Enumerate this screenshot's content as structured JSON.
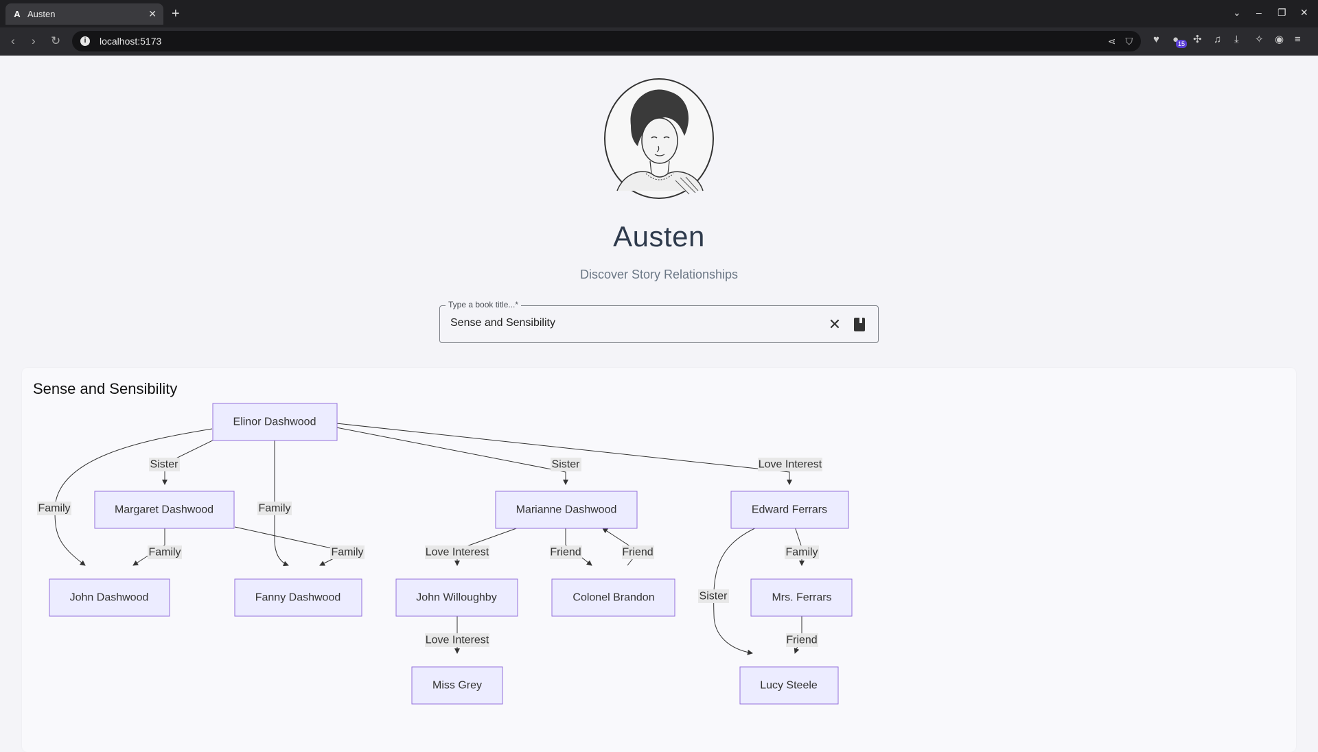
{
  "browser": {
    "tab_title": "Austen",
    "tab_favicon": "A",
    "url": "localhost:5173",
    "extension_badge": "15"
  },
  "app": {
    "title": "Austen",
    "subtitle": "Discover Story Relationships"
  },
  "search": {
    "label": "Type a book title...*",
    "value": "Sense and Sensibility"
  },
  "result": {
    "book_title": "Sense and Sensibility",
    "nodes": {
      "elinor": "Elinor Dashwood",
      "margaret": "Margaret Dashwood",
      "marianne": "Marianne Dashwood",
      "edward": "Edward Ferrars",
      "john_d": "John Dashwood",
      "fanny": "Fanny Dashwood",
      "willoughby": "John Willoughby",
      "brandon": "Colonel Brandon",
      "mrs_ferrars": "Mrs. Ferrars",
      "miss_grey": "Miss Grey",
      "lucy": "Lucy Steele"
    },
    "edges": {
      "elinor_margaret": "Sister",
      "elinor_marianne": "Sister",
      "elinor_edward": "Love Interest",
      "elinor_john": "Family",
      "elinor_fanny": "Family",
      "margaret_john": "Family",
      "margaret_fanny": "Family",
      "marianne_willoughby": "Love Interest",
      "marianne_brandon": "Friend",
      "brandon_marianne": "Friend",
      "edward_mrs_ferrars": "Family",
      "edward_lucy": "Sister",
      "willoughby_grey": "Love Interest",
      "mrs_ferrars_lucy": "Friend"
    }
  },
  "colors": {
    "node_fill": "#ececff",
    "node_stroke": "#9370db",
    "edge_label_bg": "#e8e8e8",
    "title_color": "#2e3a4c"
  }
}
